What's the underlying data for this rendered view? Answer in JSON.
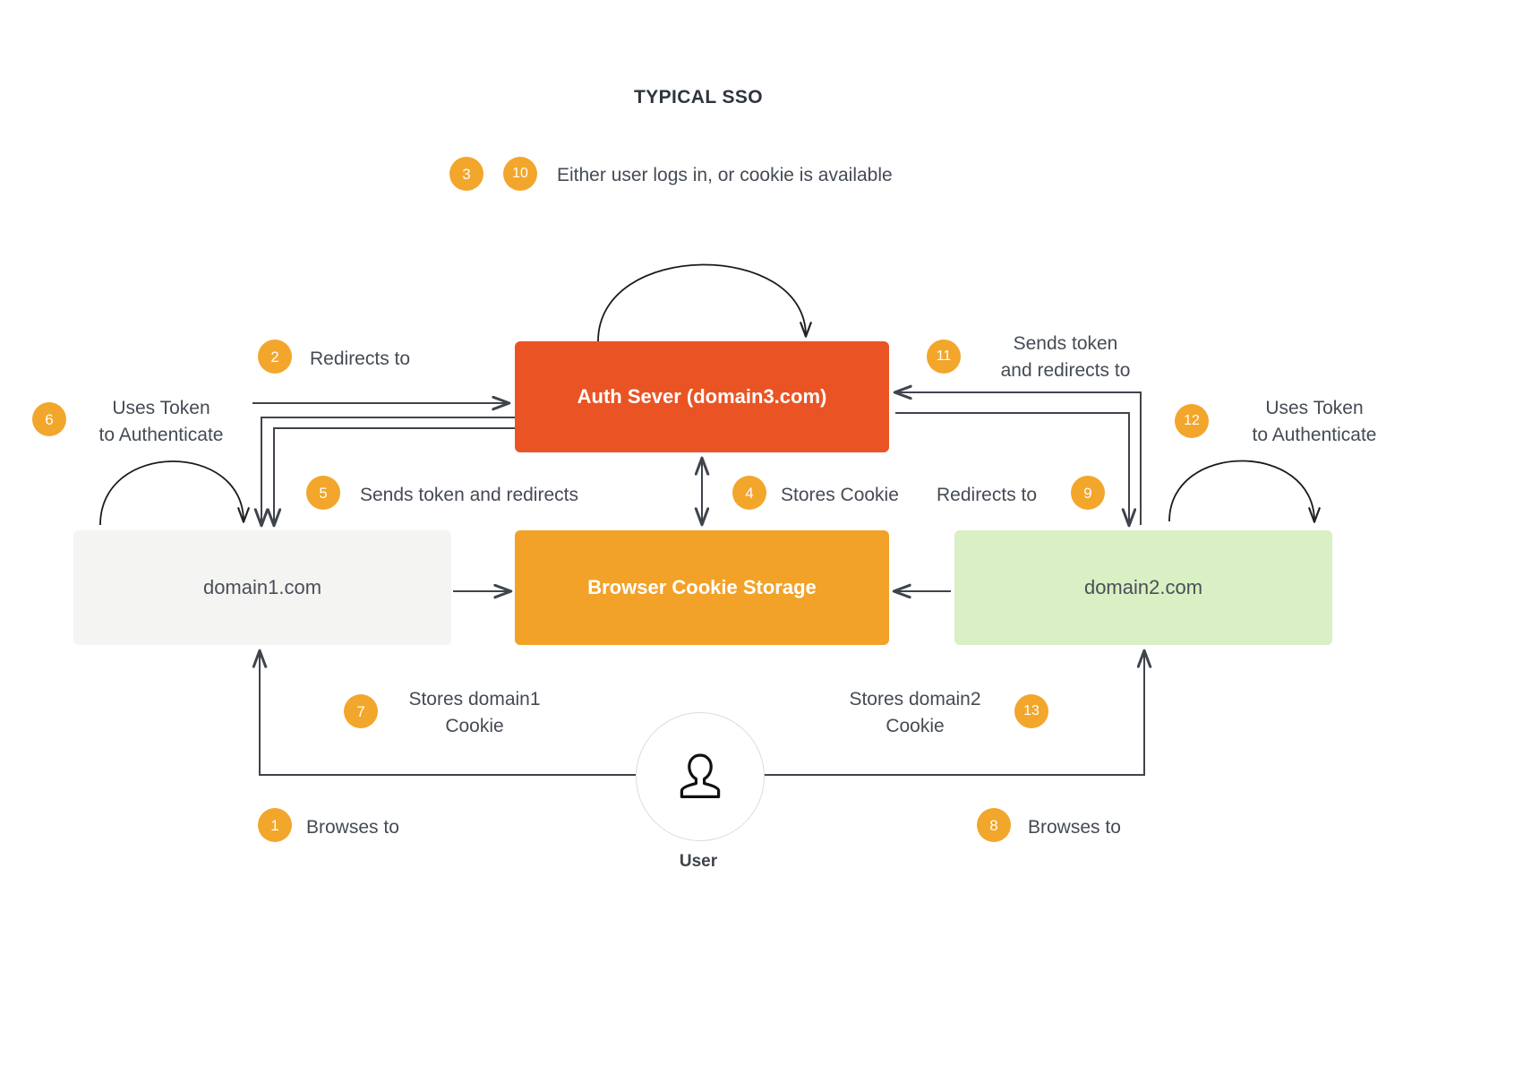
{
  "title": "TYPICAL SSO",
  "colors": {
    "badge": "#f2a62b",
    "auth_box": "#ea5425",
    "cookie_box": "#f2a229",
    "domain1_box": "#f4f4f3",
    "domain2_box": "#d9efc4",
    "text": "#454b54",
    "arrow": "#3f444c"
  },
  "nodes": {
    "auth_server": "Auth Sever (domain3.com)",
    "domain1": "domain1.com",
    "browser_cookie_storage": "Browser Cookie Storage",
    "domain2": "domain2.com",
    "user": "User",
    "user_icon": "person-icon"
  },
  "steps": [
    {
      "num": "3",
      "label": "Either user logs in, or cookie is available"
    },
    {
      "num": "10",
      "label": "Either user logs in, or cookie is available"
    },
    {
      "num": "2",
      "label": "Redirects to"
    },
    {
      "num": "6",
      "label": "Uses Token\nto Authenticate"
    },
    {
      "num": "11",
      "label": "Sends token\nand redirects to"
    },
    {
      "num": "12",
      "label": "Uses Token\nto Authenticate"
    },
    {
      "num": "5",
      "label": "Sends token and redirects"
    },
    {
      "num": "4",
      "label": "Stores Cookie"
    },
    {
      "num": "9",
      "label": "Redirects to"
    },
    {
      "num": "7",
      "label": "Stores domain1\nCookie"
    },
    {
      "num": "13",
      "label": "Stores domain2\nCookie"
    },
    {
      "num": "1",
      "label": "Browses to"
    },
    {
      "num": "8",
      "label": "Browses to"
    }
  ],
  "captions": {
    "top_note": "Either user logs in, or cookie is available",
    "redirects_to": "Redirects to",
    "uses_token_left": "Uses Token\nto Authenticate",
    "sends_token_redirects_to": "Sends token\nand redirects to",
    "uses_token_right": "Uses Token\nto Authenticate",
    "sends_token_and_redirects": "Sends token and redirects",
    "stores_cookie": "Stores Cookie",
    "redirects_to_right": "Redirects to",
    "stores_domain1_cookie": "Stores domain1\nCookie",
    "stores_domain2_cookie": "Stores domain2\nCookie",
    "browses_to_left": "Browses to",
    "browses_to_right": "Browses to"
  },
  "badges": {
    "n1": "1",
    "n2": "2",
    "n3": "3",
    "n4": "4",
    "n5": "5",
    "n6": "6",
    "n7": "7",
    "n8": "8",
    "n9": "9",
    "n10": "10",
    "n11": "11",
    "n12": "12",
    "n13": "13"
  }
}
